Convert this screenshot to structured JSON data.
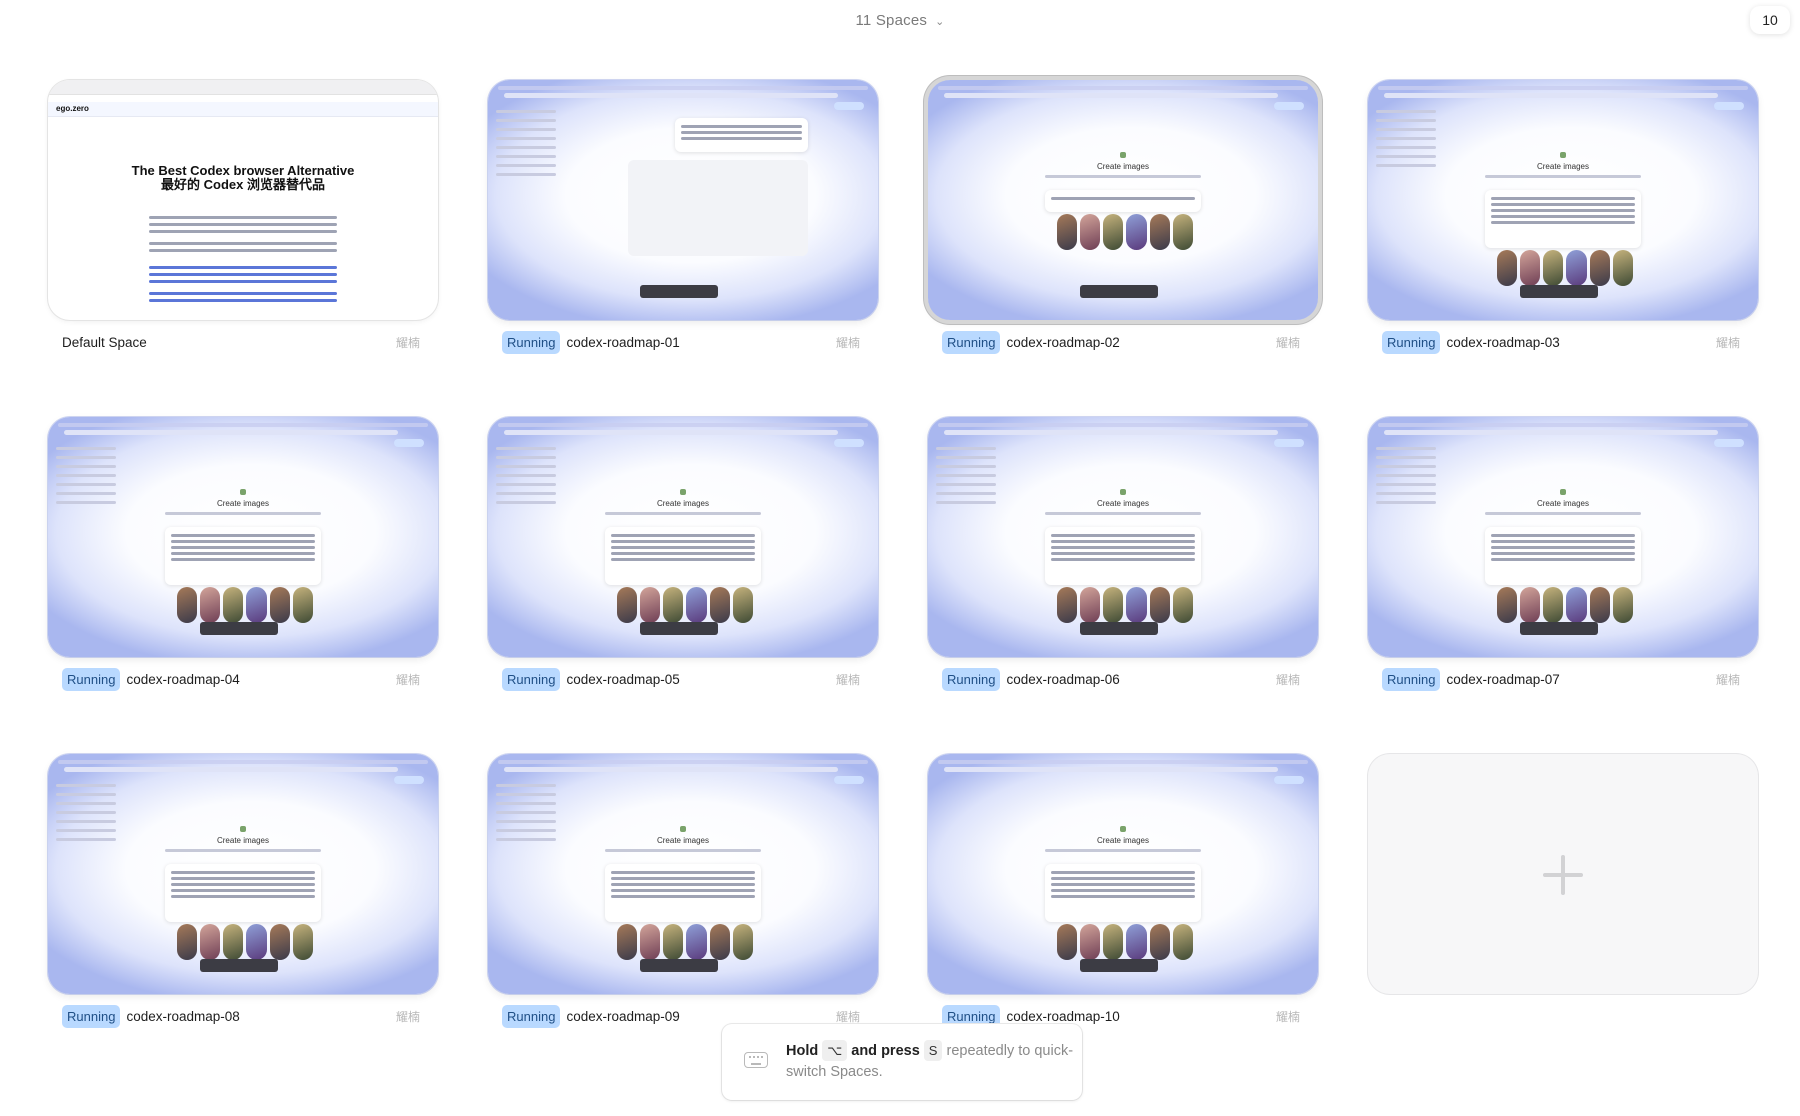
{
  "header": {
    "title": "11 Spaces",
    "count_badge": "10"
  },
  "default_space": {
    "name": "Default Space",
    "owner": "耀楠",
    "preview": {
      "logo": "ego.zero",
      "heading_en": "The Best Codex browser Alternative",
      "heading_zh": "最好的 Codex 浏览器替代品"
    }
  },
  "status_label": "Running",
  "preview_heading": "Create images",
  "spaces": [
    {
      "name": "codex-roadmap-01",
      "owner": "耀楠",
      "status": "Running"
    },
    {
      "name": "codex-roadmap-02",
      "owner": "耀楠",
      "status": "Running"
    },
    {
      "name": "codex-roadmap-03",
      "owner": "耀楠",
      "status": "Running"
    },
    {
      "name": "codex-roadmap-04",
      "owner": "耀楠",
      "status": "Running"
    },
    {
      "name": "codex-roadmap-05",
      "owner": "耀楠",
      "status": "Running"
    },
    {
      "name": "codex-roadmap-06",
      "owner": "耀楠",
      "status": "Running"
    },
    {
      "name": "codex-roadmap-07",
      "owner": "耀楠",
      "status": "Running"
    },
    {
      "name": "codex-roadmap-08",
      "owner": "耀楠",
      "status": "Running"
    },
    {
      "name": "codex-roadmap-09",
      "owner": "耀楠",
      "status": "Running"
    },
    {
      "name": "codex-roadmap-10",
      "owner": "耀楠",
      "status": "Running"
    }
  ],
  "hint": {
    "hold": "Hold",
    "option_key": "⌥",
    "and_press": "and press",
    "s_key": "S",
    "rest": "repeatedly to quick-switch Spaces."
  },
  "icons": {
    "add": "plus-icon",
    "dropdown": "chevron-down-icon",
    "keyboard": "keyboard-icon"
  }
}
